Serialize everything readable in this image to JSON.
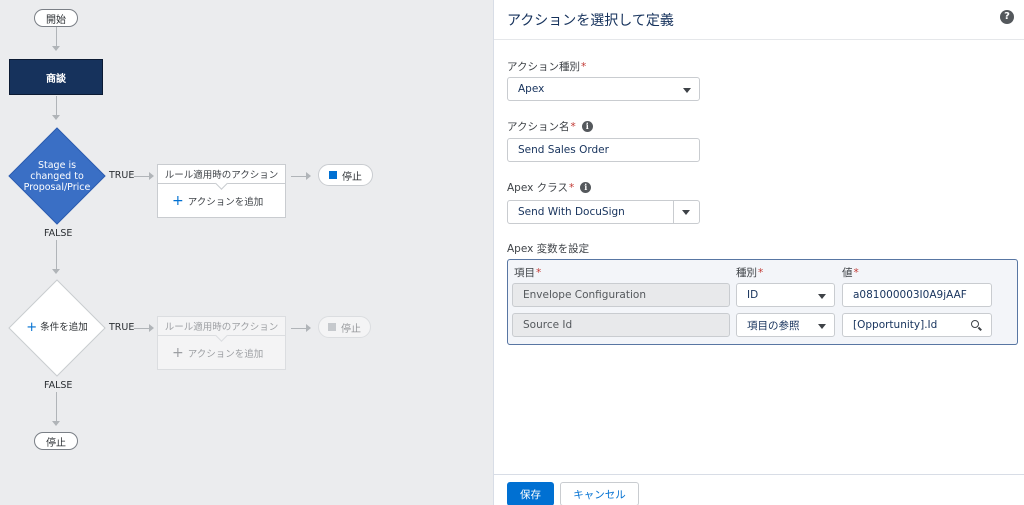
{
  "flow": {
    "start_label": "開始",
    "criteria_node_label": "商談",
    "decision1": {
      "lines": [
        "Stage is",
        "changed to",
        "Proposal/Price"
      ],
      "true_label": "TRUE",
      "false_label": "FALSE"
    },
    "action_group1": {
      "header": "ルール適用時のアクション",
      "add_label": "アクションを追加"
    },
    "stop1_label": "停止",
    "decision2": {
      "label": "条件を追加",
      "true_label": "TRUE",
      "false_label": "FALSE"
    },
    "action_group2": {
      "header": "ルール適用時のアクション",
      "add_label": "アクションを追加"
    },
    "stop2_label": "停止",
    "end_stop_label": "停止"
  },
  "panel": {
    "title": "アクションを選択して定義",
    "help_icon": "question-icon",
    "action_type": {
      "label": "アクション種別",
      "value": "Apex"
    },
    "action_name": {
      "label": "アクション名",
      "value": "Send Sales Order"
    },
    "apex_class": {
      "label": "Apex クラス",
      "value": "Send With DocuSign"
    },
    "variables": {
      "label": "Apex 変数を設定",
      "col_field": "項目",
      "col_type": "種別",
      "col_value": "値",
      "rows": [
        {
          "field": "Envelope Configuration",
          "type": "ID",
          "value": "a081000003I0A9jAAF"
        },
        {
          "field": "Source Id",
          "type": "項目の参照",
          "value": "[Opportunity].Id"
        }
      ]
    },
    "save_label": "保存",
    "cancel_label": "キャンセル"
  },
  "colors": {
    "accent": "#0070d2",
    "navy": "#16325c",
    "decision_fill": "#3a6fc5",
    "required": "#c23934"
  }
}
